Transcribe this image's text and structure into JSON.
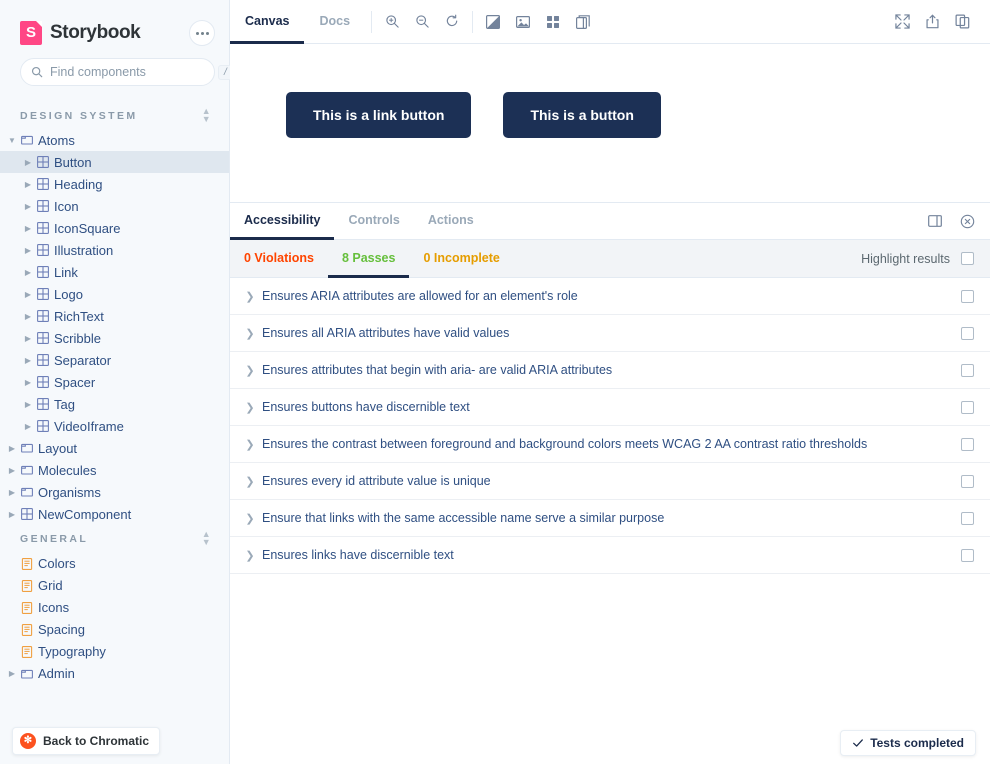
{
  "sidebar": {
    "brand": "Storybook",
    "logo_color": "#FF4785",
    "menu_icon": "ellipsis-icon",
    "search": {
      "placeholder": "Find components",
      "value": "",
      "shortcut": "/"
    },
    "sections": [
      {
        "title": "DESIGN SYSTEM",
        "items": [
          {
            "label": "Atoms",
            "depth": 1,
            "icon": "folder-icon",
            "state": "open",
            "selected": false
          },
          {
            "label": "Button",
            "depth": 2,
            "icon": "component-icon",
            "state": "closed",
            "selected": true
          },
          {
            "label": "Heading",
            "depth": 2,
            "icon": "component-icon",
            "state": "closed",
            "selected": false
          },
          {
            "label": "Icon",
            "depth": 2,
            "icon": "component-icon",
            "state": "closed",
            "selected": false
          },
          {
            "label": "IconSquare",
            "depth": 2,
            "icon": "component-icon",
            "state": "closed",
            "selected": false
          },
          {
            "label": "Illustration",
            "depth": 2,
            "icon": "component-icon",
            "state": "closed",
            "selected": false
          },
          {
            "label": "Link",
            "depth": 2,
            "icon": "component-icon",
            "state": "closed",
            "selected": false
          },
          {
            "label": "Logo",
            "depth": 2,
            "icon": "component-icon",
            "state": "closed",
            "selected": false
          },
          {
            "label": "RichText",
            "depth": 2,
            "icon": "component-icon",
            "state": "closed",
            "selected": false
          },
          {
            "label": "Scribble",
            "depth": 2,
            "icon": "component-icon",
            "state": "closed",
            "selected": false
          },
          {
            "label": "Separator",
            "depth": 2,
            "icon": "component-icon",
            "state": "closed",
            "selected": false
          },
          {
            "label": "Spacer",
            "depth": 2,
            "icon": "component-icon",
            "state": "closed",
            "selected": false
          },
          {
            "label": "Tag",
            "depth": 2,
            "icon": "component-icon",
            "state": "closed",
            "selected": false
          },
          {
            "label": "VideoIframe",
            "depth": 2,
            "icon": "component-icon",
            "state": "closed",
            "selected": false
          },
          {
            "label": "Layout",
            "depth": 1,
            "icon": "folder-icon",
            "state": "closed",
            "selected": false
          },
          {
            "label": "Molecules",
            "depth": 1,
            "icon": "folder-icon",
            "state": "closed",
            "selected": false
          },
          {
            "label": "Organisms",
            "depth": 1,
            "icon": "folder-icon",
            "state": "closed",
            "selected": false
          },
          {
            "label": "NewComponent",
            "depth": 1,
            "icon": "component-icon",
            "state": "closed",
            "selected": false
          }
        ]
      },
      {
        "title": "GENERAL",
        "items": [
          {
            "label": "Colors",
            "depth": 1,
            "icon": "document-icon",
            "state": "none",
            "selected": false
          },
          {
            "label": "Grid",
            "depth": 1,
            "icon": "document-icon",
            "state": "none",
            "selected": false
          },
          {
            "label": "Icons",
            "depth": 1,
            "icon": "document-icon",
            "state": "none",
            "selected": false
          },
          {
            "label": "Spacing",
            "depth": 1,
            "icon": "document-icon",
            "state": "none",
            "selected": false
          },
          {
            "label": "Typography",
            "depth": 1,
            "icon": "document-icon",
            "state": "none",
            "selected": false
          },
          {
            "label": "Admin",
            "depth": 1,
            "icon": "folder-icon",
            "state": "closed",
            "selected": false
          }
        ]
      }
    ],
    "chromatic": {
      "label": "Back to Chromatic",
      "icon": "chromatic-logo-icon",
      "color": "#FC521F"
    }
  },
  "toolbar": {
    "tabs": [
      {
        "label": "Canvas",
        "active": true
      },
      {
        "label": "Docs",
        "active": false
      }
    ],
    "left_tools": [
      "zoom-in-icon",
      "zoom-out-icon",
      "zoom-reset-icon"
    ],
    "right_tools": [
      "background-icon",
      "image-icon",
      "grid-icon",
      "layout-icon"
    ],
    "end_tools": [
      "fullscreen-icon",
      "share-icon",
      "copy-icon"
    ]
  },
  "preview": {
    "buttons": [
      {
        "label": "This is a link button"
      },
      {
        "label": "This is a button"
      }
    ],
    "button_color": "#1C3055"
  },
  "panel": {
    "tabs": [
      {
        "label": "Accessibility",
        "active": true
      },
      {
        "label": "Controls",
        "active": false
      },
      {
        "label": "Actions",
        "active": false
      }
    ],
    "panel_icons": [
      "panel-position-icon",
      "close-panel-icon"
    ],
    "stats": [
      {
        "label": "0 Violations",
        "color": "#FF4400",
        "active": false
      },
      {
        "label": "8 Passes",
        "color": "#66BF3C",
        "active": true
      },
      {
        "label": "0 Incomplete",
        "color": "#E69D00",
        "active": false
      }
    ],
    "highlight": {
      "label": "Highlight results",
      "checked": false
    },
    "results": [
      {
        "text": "Ensures ARIA attributes are allowed for an element's role",
        "checked": false
      },
      {
        "text": "Ensures all ARIA attributes have valid values",
        "checked": false
      },
      {
        "text": "Ensures attributes that begin with aria- are valid ARIA attributes",
        "checked": false
      },
      {
        "text": "Ensures buttons have discernible text",
        "checked": false
      },
      {
        "text": "Ensures the contrast between foreground and background colors meets WCAG 2 AA contrast ratio thresholds",
        "checked": false
      },
      {
        "text": "Ensures every id attribute value is unique",
        "checked": false
      },
      {
        "text": "Ensure that links with the same accessible name serve a similar purpose",
        "checked": false
      },
      {
        "text": "Ensures links have discernible text",
        "checked": false
      }
    ],
    "status": {
      "label": "Tests completed",
      "icon": "check-icon"
    }
  }
}
